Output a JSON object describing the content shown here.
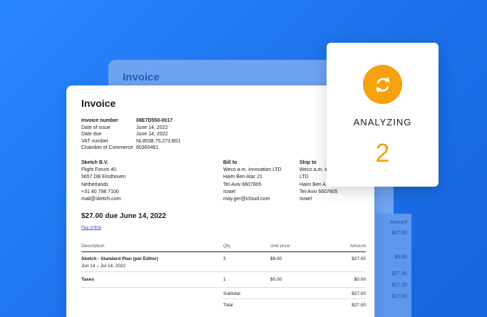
{
  "back_card": {
    "title": "Invoice",
    "amounts_header": "Amount",
    "amounts": [
      "$27.00",
      "$0.00",
      "$27.00",
      "$27.00",
      "$27.00"
    ]
  },
  "invoice": {
    "title": "Invoice",
    "meta": [
      {
        "key": "Invoice number",
        "value": "08E7D550-0017"
      },
      {
        "key": "Date of issue",
        "value": "June 14, 2022"
      },
      {
        "key": "Date due",
        "value": "June 14, 2022"
      },
      {
        "key": "VAT number",
        "value": "NL8538.75.273.B01"
      },
      {
        "key": "Chamber of Commerce",
        "value": "60360461"
      }
    ],
    "from": {
      "name": "Sketch B.V.",
      "lines": [
        "Flight Forum 40",
        "5657 DB Eindhoven",
        "Netherlands",
        "+31 40 798 7100",
        "mail@sketch.com"
      ]
    },
    "bill_to": {
      "heading": "Bill to",
      "lines": [
        "Weco a.m. innovation LTD",
        "Haim Ben Atar 21",
        "Tel-Aviv 6607805",
        "Israel",
        "may.ger@icloud.com"
      ]
    },
    "ship_to": {
      "heading": "Ship to",
      "lines": [
        "Weco a.m. in",
        "LTD",
        "Haim Ben A",
        "Tel-Aviv 6607805",
        "Israel"
      ]
    },
    "due_line": "$27.00 due June 14, 2022",
    "pay_link": "Pay online",
    "table": {
      "headers": [
        "Description",
        "Qty",
        "Unit price",
        "Amount"
      ],
      "rows": [
        {
          "desc": "Sketch - Standard Plan (per Editor)",
          "sub": "Jun 14 – Jul 14, 2022",
          "qty": "3",
          "unit": "$9.00",
          "amount": "$27.00"
        },
        {
          "desc": "Taxes",
          "sub": "",
          "qty": "1",
          "unit": "$0.00",
          "amount": "$0.00"
        }
      ],
      "subtotal_label": "Subtotal",
      "subtotal": "$27.00",
      "total_label": "Total",
      "total": "$27.00"
    }
  },
  "analyzing": {
    "icon": "refresh-icon",
    "label": "ANALYZING",
    "count": "2",
    "accent": "#f7a10e"
  }
}
